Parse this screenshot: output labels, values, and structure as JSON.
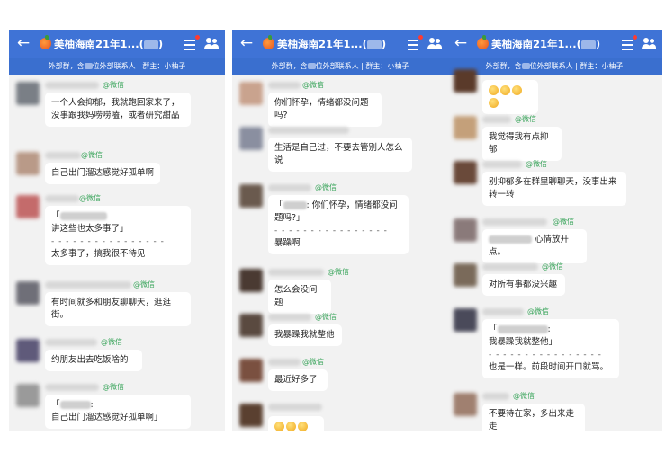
{
  "header": {
    "title": "美柚海南21年1...(",
    "title_suffix": ")",
    "subtitle_pre": "外部群，含",
    "subtitle_post": "位外部联系人 | 群主：小柚子"
  },
  "tag_label": "@微信",
  "panel1": {
    "m1": "一个人会抑郁，我就跑回家来了，没事跟我妈唠唠嗑，或者研究甜品",
    "m2": "自己出门溜达感觉好孤单啊",
    "m3_q1": "「",
    "m3_q2": "讲这些也太多事了」",
    "m3_dash": "- - - - - - - - - - - - - - - -",
    "m3_r": "太多事了，搞我很不待见",
    "m4": "有时间就多和朋友聊聊天，逛逛街。",
    "m5": "约朋友出去吃饭啥的",
    "m6_q1": "「",
    "m6_q2": ":",
    "m6_q3": "自己出门溜达感觉好孤单啊」"
  },
  "panel2": {
    "m1": "你们怀孕，情绪都没问题吗?",
    "m2": "生活是自己过，不要去管别人怎么说",
    "m3_q1": "「",
    "m3_q2": ": 你们怀孕，情绪都没问题吗?」",
    "m3_dash": "- - - - - - - - - - - - - - - -",
    "m3_r": "暴躁啊",
    "m4": "怎么会没问题",
    "m5": "我暴躁我就整他",
    "m6": "最近好多了"
  },
  "panel3": {
    "m2": "我觉得我有点抑郁",
    "m3": "别抑郁多在群里聊聊天，没事出来转一转",
    "m4": "心情放开点。",
    "m5": "对所有事都没兴趣",
    "m6_q1": "「",
    "m6_q2": ":",
    "m6_q3": "我暴躁我就整他」",
    "m6_dash": "- - - - - - - - - - - - - - - -",
    "m6_r": "也是一样。前段时间开口就骂。",
    "m7": "不要待在家，多出来走走"
  },
  "colors": {
    "header": "#3f73d6",
    "subheader": "#3a6fcf",
    "wechat_tag": "#3ba55c",
    "chat_bg": "#f2f2f2"
  },
  "icons": [
    "back-arrow-icon",
    "group-avatar-orange-icon",
    "menu-icon",
    "notification-dot",
    "group-members-icon",
    "emoji-icon"
  ]
}
